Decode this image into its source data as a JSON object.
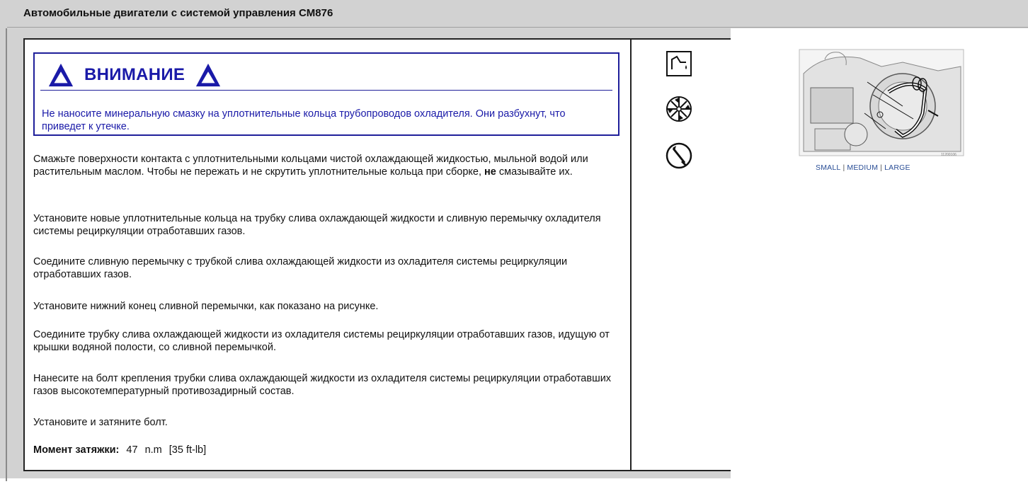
{
  "header": {
    "title": "Автомобильные двигатели с системой управления CM876"
  },
  "warning": {
    "title": "ВНИМАНИЕ",
    "text": "Не наносите минеральную смазку на уплотнительные кольца трубопроводов охладителя. Они разбухнут, что приведет к утечке.",
    "color": "#1a1aa8"
  },
  "instructions": {
    "p1_before": "Смажьте поверхности контакта с уплотнительными кольцами чистой охлаждающей жидкостью, мыльной водой или растительным маслом. Чтобы не пережать и не скрутить уплотнительные кольца при сборке,",
    "p1_bold": "не",
    "p1_after": "смазывайте их.",
    "p2": "Установите новые уплотнительные кольца на трубку слива охлаждающей жидкости и сливную перемычку охладителя системы рециркуляции отработавших газов.",
    "p3": "Соедините сливную перемычку с трубкой слива охлаждающей жидкости из охладителя системы рециркуляции отработавших газов.",
    "p4": "Установите нижний конец сливной перемычки, как показано на рисунке.",
    "p5": "Соедините трубку слива охлаждающей жидкости из охладителя системы рециркуляции отработавших газов, идущую от крышки водяной полости, со сливной перемычкой.",
    "p6": "Нанесите на болт крепления трубки слива охлаждающей жидкости из охладителя системы рециркуляции отработавших газов высокотемпературный противозадирный состав.",
    "p7": "Установите и затяните болт."
  },
  "torque": {
    "label": "Момент затяжки:",
    "value": "47",
    "unit": "n.m",
    "imperial": "[35 ft-lb]"
  },
  "icons": [
    "lubricant-oil-icon",
    "coolant-fan-icon",
    "anti-seize-brush-icon"
  ],
  "figure": {
    "id_text": "11200106",
    "sizes": [
      "SMALL",
      "MEDIUM",
      "LARGE"
    ],
    "separator": "|"
  }
}
